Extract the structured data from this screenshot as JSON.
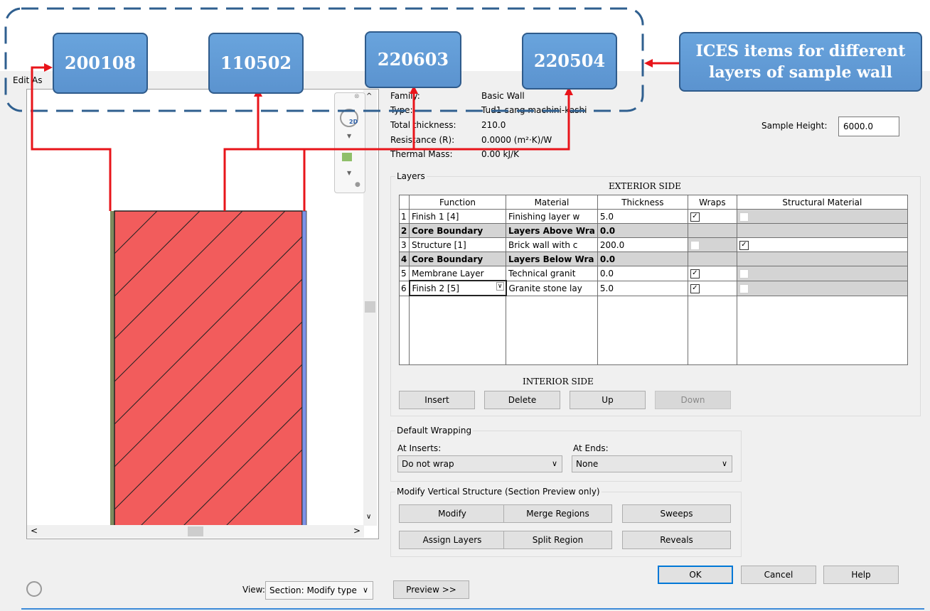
{
  "dialog": {
    "title_partial": "Edit As",
    "properties": [
      {
        "label": "Family:",
        "value": "Basic Wall"
      },
      {
        "label": "Type:",
        "value": "Tud1-sang machini-kashi"
      },
      {
        "label": "Total thickness:",
        "value": "210.0"
      },
      {
        "label": "Resistance (R):",
        "value": "0.0000 (m²·K)/W"
      },
      {
        "label": "Thermal Mass:",
        "value": "0.00 kJ/K"
      }
    ],
    "sample_height": {
      "label": "Sample Height:",
      "value": "6000.0"
    }
  },
  "layers": {
    "group_title": "Layers",
    "exterior_label": "EXTERIOR SIDE",
    "interior_label": "INTERIOR SIDE",
    "columns": [
      "Function",
      "Material",
      "Thickness",
      "Wraps",
      "Structural Material"
    ],
    "rows": [
      {
        "num": "1",
        "function": "Finish 1 [4]",
        "material": "Finishing layer w",
        "thickness": "5.0",
        "wraps": true,
        "structural": false
      },
      {
        "num": "2",
        "function": "Core Boundary",
        "material": "Layers Above Wra",
        "thickness": "0.0",
        "wraps": null,
        "structural": null
      },
      {
        "num": "3",
        "function": "Structure [1]",
        "material": "Brick wall with c",
        "thickness": "200.0",
        "wraps": false,
        "structural": true
      },
      {
        "num": "4",
        "function": "Core Boundary",
        "material": "Layers Below Wra",
        "thickness": "0.0",
        "wraps": null,
        "structural": null
      },
      {
        "num": "5",
        "function": "Membrane Layer",
        "material": "Technical granit",
        "thickness": "0.0",
        "wraps": true,
        "structural": false
      },
      {
        "num": "6",
        "function": "Finish 2 [5]",
        "material": "Granite stone lay",
        "thickness": "5.0",
        "wraps": true,
        "structural": false
      }
    ],
    "buttons": {
      "insert": "Insert",
      "delete": "Delete",
      "up": "Up",
      "down": "Down"
    }
  },
  "wrapping": {
    "group_title": "Default Wrapping",
    "at_inserts_label": "At Inserts:",
    "at_inserts_value": "Do not wrap",
    "at_ends_label": "At Ends:",
    "at_ends_value": "None"
  },
  "vertical": {
    "group_title": "Modify Vertical Structure (Section Preview only)",
    "buttons": {
      "modify": "Modify",
      "merge": "Merge Regions",
      "sweeps": "Sweeps",
      "assign": "Assign Layers",
      "split": "Split Region",
      "reveals": "Reveals"
    }
  },
  "footer": {
    "ok": "OK",
    "cancel": "Cancel",
    "help": "Help",
    "view_label": "View:",
    "view_value": "Section: Modify type",
    "preview": "Preview >>"
  },
  "nav": {
    "badge_2d": "2D"
  },
  "annotations": {
    "codes": [
      "200108",
      "110502",
      "220603",
      "220504"
    ],
    "caption_line1": "ICES items for different",
    "caption_line2": "layers of sample wall"
  },
  "colors": {
    "wall_fill": "#f25c5c",
    "arrow": "#e8141a",
    "callout": "#5b93cf",
    "dash": "#2f5f8f"
  }
}
